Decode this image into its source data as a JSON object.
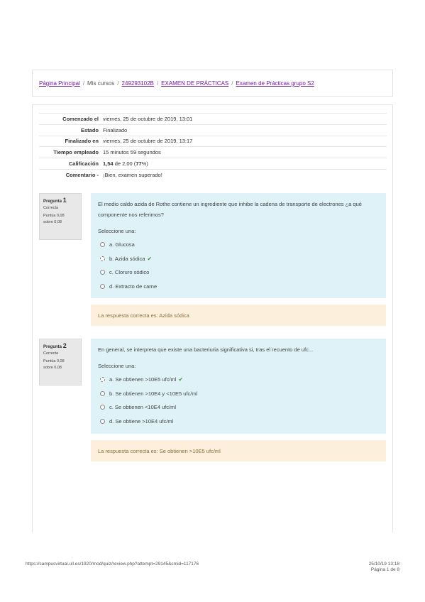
{
  "breadcrumb": {
    "items": [
      {
        "label": "Página Principal",
        "link": true
      },
      {
        "label": "Mis cursos",
        "link": false
      },
      {
        "label": "249293102B",
        "link": true
      },
      {
        "label": "EXAMEN DE PRÁCTICAS",
        "link": true
      },
      {
        "label": "Examen de Prácticas grupo S2",
        "link": true
      }
    ],
    "separator": "/"
  },
  "summary": [
    {
      "label": "Comenzado el",
      "value": "viernes, 25 de octubre de 2019, 13:01"
    },
    {
      "label": "Estado",
      "value": "Finalizado"
    },
    {
      "label": "Finalizado en",
      "value": "viernes, 25 de octubre de 2019, 13:17"
    },
    {
      "label": "Tiempo empleado",
      "value": "15 minutos 59 segundos"
    },
    {
      "label": "Calificación",
      "value_bold": "1,54",
      "value_mid": " de 2,00 (",
      "value_bold2": "77",
      "value_end": "%)"
    },
    {
      "label": "Comentario -",
      "value": "¡Bien, examen superado!"
    }
  ],
  "questions": [
    {
      "label": "Pregunta",
      "number": "1",
      "state": "Correcta",
      "grade_line1": "Puntúa 0,08",
      "grade_line2": "sobre 0,08",
      "text": "El medio caldo azida de Rothe contiene un ingrediente que inhibe la cadena de transporte de electrones ¿a qué componente nos referimos?",
      "prompt": "Seleccione una:",
      "options": [
        {
          "label": "a. Glucosa",
          "selected": false,
          "correct": false
        },
        {
          "label": "b. Azida sódica",
          "selected": true,
          "correct": true
        },
        {
          "label": "c. Cloruro sódico",
          "selected": false,
          "correct": false
        },
        {
          "label": "d. Extracto de carne",
          "selected": false,
          "correct": false
        }
      ],
      "feedback": "La respuesta correcta es: Azida sódica"
    },
    {
      "label": "Pregunta",
      "number": "2",
      "state": "Correcta",
      "grade_line1": "Puntúa 0,08",
      "grade_line2": "sobre 0,08",
      "text": "En general, se interpreta que existe una bacteriuria significativa si, tras el recuento de ufc...",
      "prompt": "Seleccione una:",
      "options": [
        {
          "label": "a. Se obtienen >10E5 ufc/ml",
          "selected": true,
          "correct": true
        },
        {
          "label": "b. Se obtienen >10E4 y <10E5 ufc/ml",
          "selected": false,
          "correct": false
        },
        {
          "label": "c. Se obtienen <10E4 ufc/ml",
          "selected": false,
          "correct": false
        },
        {
          "label": "d. Se obtiene >10E4 ufc/ml",
          "selected": false,
          "correct": false
        }
      ],
      "feedback": "La respuesta correcta es: Se obtienen >10E5 ufc/ml"
    }
  ],
  "footer": {
    "url": "https://campusvirtual.ull.es/1920/mod/quiz/review.php?attempt=29145&cmid=117176",
    "datetime": "25/10/19 13:18",
    "page": "Página 1 de 8"
  },
  "icons": {
    "check": "check-icon"
  },
  "colors": {
    "link": "#6a1b9a",
    "question_bg": "#def2f8",
    "feedback_bg": "#fcefdc",
    "check": "#3c9a3c"
  }
}
